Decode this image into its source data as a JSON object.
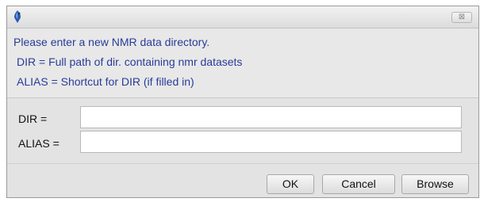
{
  "dialog": {
    "close_glyph": "⊠",
    "app_icon": "topspin-icon"
  },
  "messages": [
    "Please enter a new NMR data directory.",
    "DIR = Full path of dir. containing nmr datasets",
    "ALIAS = Shortcut for DIR (if filled in)"
  ],
  "fields": {
    "dir_label": "DIR =",
    "dir_value": "",
    "alias_label": "ALIAS =",
    "alias_value": ""
  },
  "buttons": {
    "ok": "OK",
    "cancel": "Cancel",
    "browse": "Browse"
  },
  "colors": {
    "message_text": "#283c9a",
    "icon_blue": "#2a5db0"
  }
}
